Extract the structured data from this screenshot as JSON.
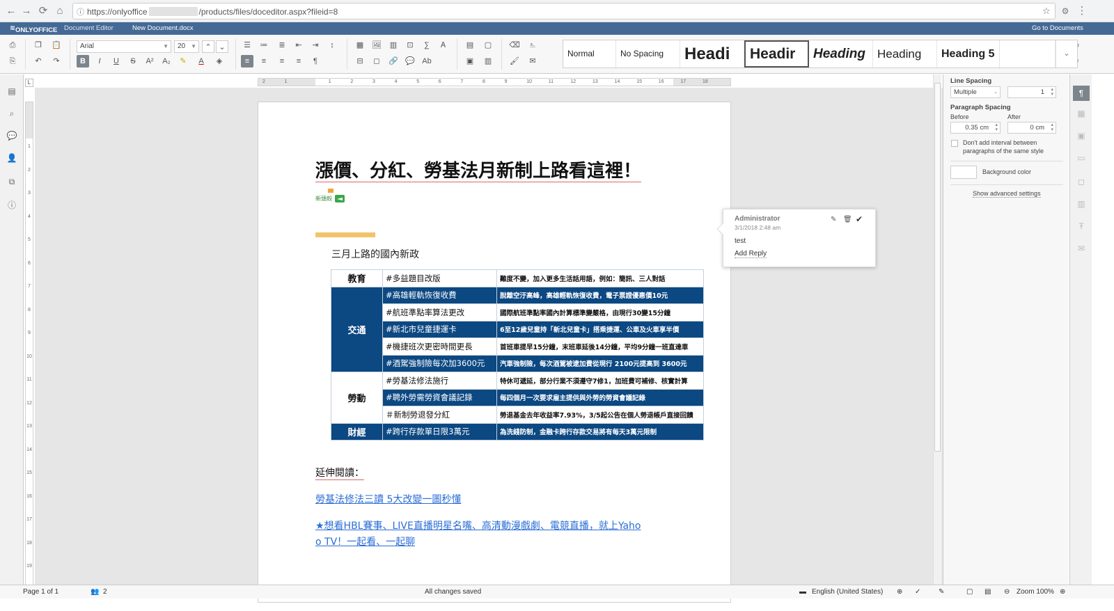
{
  "browser": {
    "url_prefix": "https://onlyoffice",
    "url_suffix": "/products/files/doceditor.aspx?fileid=8"
  },
  "header": {
    "brand": "ONLYOFFICE",
    "product": "Document Editor",
    "doc_name": "New Document.docx",
    "go_to_docs": "Go to Documents"
  },
  "toolbar": {
    "font_name": "Arial",
    "font_size": "20",
    "styles": [
      "Normal",
      "No Spacing",
      "Headi",
      "Headir",
      "Heading",
      "Heading",
      "Heading 5"
    ]
  },
  "document": {
    "title": "漲價、分紅、勞基法月新制上路看這裡！",
    "section_heading": "三月上路的國內新政",
    "table": [
      {
        "cat": "教育",
        "rows": [
          {
            "tag": "#多益題目改版",
            "desc": "難度不變，加入更多生活話用語，例如：簡訊、三人對話"
          }
        ]
      },
      {
        "cat": "交通",
        "rows": [
          {
            "tag": "#高雄輕軌恢復收費",
            "desc": "脫離空汙高峰，高雄輕軌恢復收費，電子票證優惠價10元"
          },
          {
            "tag": "#航班準點率算法更改",
            "desc": "國際航班準點率國內計算標準變嚴格，由現行30變15分鐘"
          },
          {
            "tag": "#新北市兒童捷運卡",
            "desc": "6至12歲兒童持「新北兒童卡」搭乘捷運、公車及火車享半價"
          },
          {
            "tag": "#機捷班次更密時間更長",
            "desc": "首班車提早15分鐘，末班車延後14分鐘，平均9分鐘一班直達車"
          },
          {
            "tag": "#酒駕強制險每次加3600元",
            "desc": "汽車強制險，每次酒駕被逮加費從現行 2100元提高到 3600元"
          }
        ]
      },
      {
        "cat": "勞動",
        "rows": [
          {
            "tag": "#勞基法修法施行",
            "desc": "特休可遞延，部分行業不須遵守7修1，加班費可補修、核實計算"
          },
          {
            "tag": "#聘外勞需勞資會議記錄",
            "desc": "每四個月一次要求雇主提供與外勞的勞資會議記錄"
          },
          {
            "tag": "＃新制勞退發分紅",
            "desc": "勞退基金去年收益率7.93%，3/5起公告在個人勞退帳戶直接回饋"
          }
        ]
      },
      {
        "cat": "財經",
        "rows": [
          {
            "tag": "#跨行存款單日限3萬元",
            "desc": "為洗錢防制，金融卡跨行存款交易將有每天3萬元限制"
          }
        ]
      }
    ],
    "read_more": "延伸閱讀：",
    "link1": "勞基法修法三讀 5大改變一圖秒懂",
    "link2_line1": "★想看HBL賽事、LIVE直播明星名嘴、高清動漫戲劇、電競直播，就上Yaho",
    "link2_line2": "o TV！一起看、一起聊"
  },
  "comment": {
    "author": "Administrator",
    "date": "3/1/2018 2:48 am",
    "text": "test",
    "add_reply": "Add Reply"
  },
  "right_panel": {
    "line_spacing_label": "Line Spacing",
    "line_spacing_mode": "Multiple",
    "line_spacing_value": "1",
    "paragraph_spacing_label": "Paragraph Spacing",
    "before_label": "Before",
    "after_label": "After",
    "before_value": "0.35 cm",
    "after_value": "0 cm",
    "no_interval_line1": "Don't add interval between",
    "no_interval_line2": "paragraphs of the same style",
    "background_color_label": "Background color",
    "advanced_settings": "Show advanced settings"
  },
  "status_bar": {
    "page": "Page 1 of 1",
    "users": "2",
    "saved": "All changes saved",
    "language": "English (United States)",
    "zoom": "Zoom 100%"
  },
  "colors": {
    "header_blue": "#446995",
    "table_dark_blue": "#0c4882",
    "link_blue": "#2a6dd6",
    "accent_gold": "#f2c46a"
  }
}
